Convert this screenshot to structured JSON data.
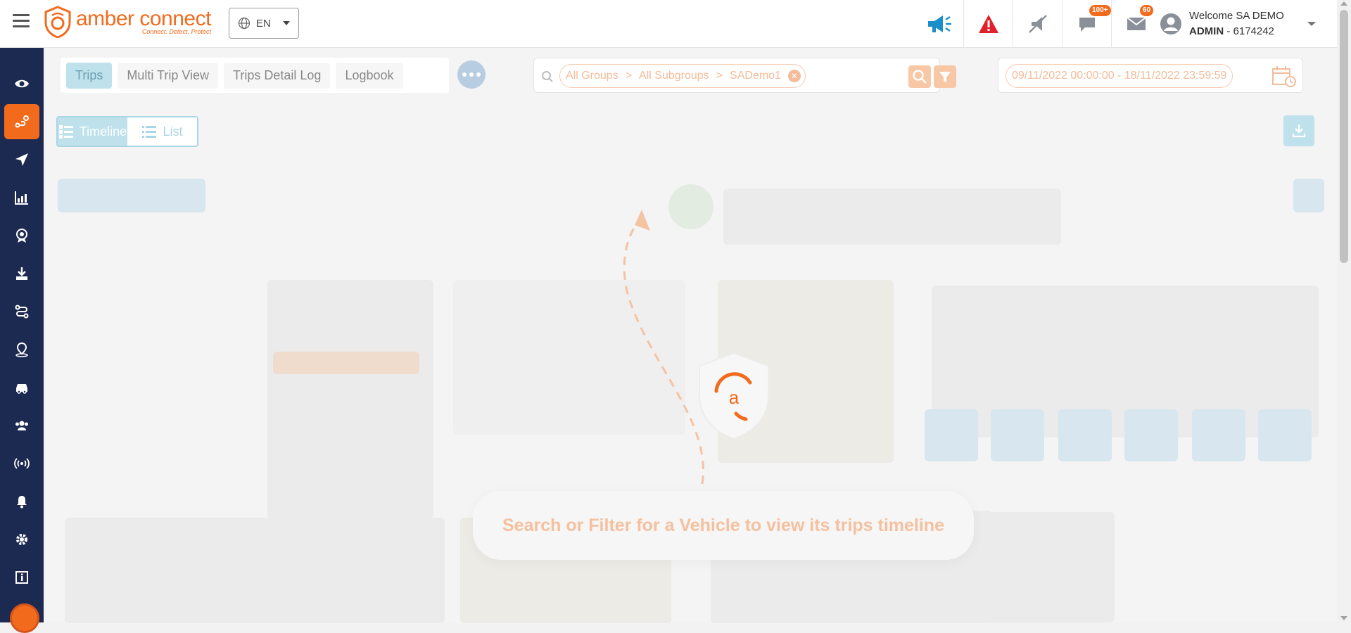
{
  "brand": {
    "name": "amber connect",
    "tagline": "Connect. Detect. Protect",
    "accent": "#f26b1d",
    "sidebar_bg": "#1c2951"
  },
  "header": {
    "language": "EN",
    "icons": [
      {
        "name": "announcement-icon",
        "badge": ""
      },
      {
        "name": "alert-icon",
        "badge": ""
      },
      {
        "name": "mute-notifications-icon",
        "badge": ""
      },
      {
        "name": "chat-icon",
        "badge": "100+"
      },
      {
        "name": "mail-icon",
        "badge": "60"
      }
    ],
    "user": {
      "welcome": "Welcome SA DEMO",
      "role": "ADMIN",
      "account_id": "- 6174242"
    }
  },
  "sidebar": {
    "items": [
      {
        "icon": "eye-icon",
        "active": false
      },
      {
        "icon": "trips-route-icon",
        "active": true
      },
      {
        "icon": "navigation-icon",
        "active": false
      },
      {
        "icon": "analytics-icon",
        "active": false
      },
      {
        "icon": "award-icon",
        "active": false
      },
      {
        "icon": "download-icon",
        "active": false
      },
      {
        "icon": "route-plan-icon",
        "active": false
      },
      {
        "icon": "geofence-icon",
        "active": false
      },
      {
        "icon": "vehicle-icon",
        "active": false
      },
      {
        "icon": "users-icon",
        "active": false
      },
      {
        "icon": "signal-icon",
        "active": false
      },
      {
        "icon": "bell-icon",
        "active": false
      },
      {
        "icon": "settings-icon",
        "active": false
      },
      {
        "icon": "info-icon",
        "active": false
      }
    ]
  },
  "tabs": [
    {
      "label": "Trips",
      "active": true
    },
    {
      "label": "Multi Trip View",
      "active": false
    },
    {
      "label": "Trips Detail Log",
      "active": false
    },
    {
      "label": "Logbook",
      "active": false
    }
  ],
  "filter": {
    "group": "All Groups",
    "subgroup": "All Subgroups",
    "vehicle": "SADemo1",
    "separator": ">",
    "date_range": "09/11/2022 00:00:00 - 18/11/2022 23:59:59"
  },
  "view_toggle": {
    "timeline_label": "Timeline",
    "list_label": "List"
  },
  "empty_state": {
    "message": "Search or Filter for a Vehicle to view its trips timeline"
  }
}
